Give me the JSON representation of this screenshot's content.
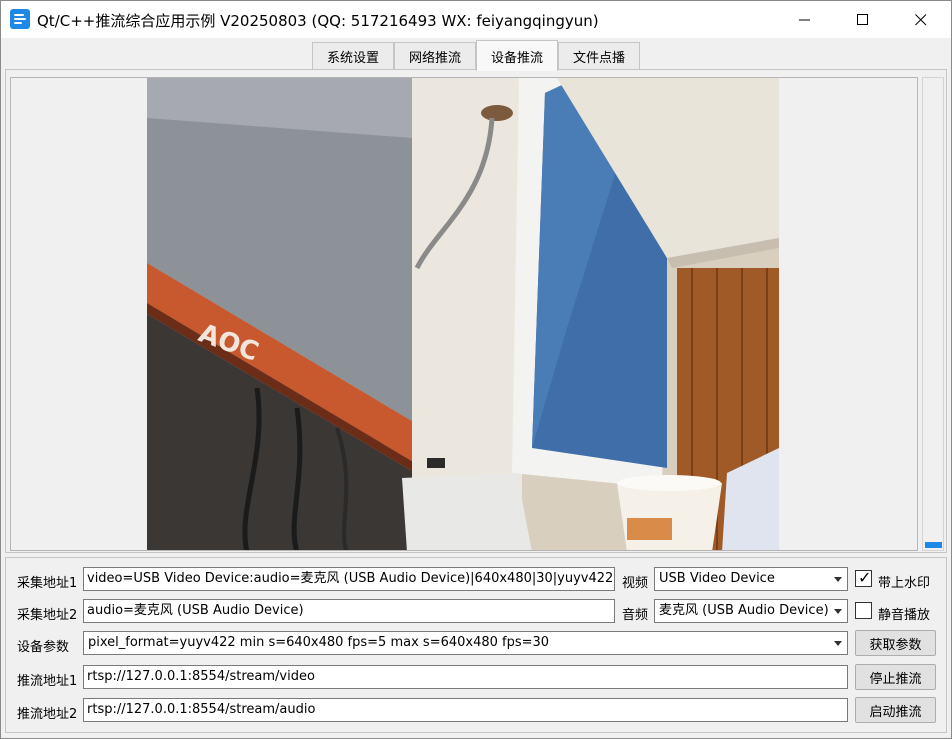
{
  "window": {
    "title": "Qt/C++推流综合应用示例 V20250803 (QQ: 517216493 WX: feiyangqingyun)",
    "icon": "app-menu-icon"
  },
  "tabs": [
    {
      "label": "系统设置",
      "active": false
    },
    {
      "label": "网络推流",
      "active": false
    },
    {
      "label": "设备推流",
      "active": true
    },
    {
      "label": "文件点播",
      "active": false
    }
  ],
  "form": {
    "row1": {
      "label": "采集地址1",
      "value": "video=USB Video Device:audio=麦克风 (USB Audio Device)|640x480|30|yuyv422",
      "video_label": "视频",
      "video_selected": "USB Video Device",
      "watermark_label": "带上水印",
      "watermark_checked": true
    },
    "row2": {
      "label": "采集地址2",
      "value": "audio=麦克风 (USB Audio Device)",
      "audio_label": "音频",
      "audio_selected": "麦克风 (USB Audio Device)",
      "mute_label": "静音播放",
      "mute_checked": false
    },
    "row3": {
      "label": "设备参数",
      "selected": "pixel_format=yuyv422 min s=640x480 fps=5 max s=640x480 fps=30",
      "button": "获取参数"
    },
    "row4": {
      "label": "推流地址1",
      "value": "rtsp://127.0.0.1:8554/stream/video",
      "button": "停止推流"
    },
    "row5": {
      "label": "推流地址2",
      "value": "rtsp://127.0.0.1:8554/stream/audio",
      "button": "启动推流"
    }
  },
  "video": {
    "brand_on_monitor": "AOC"
  },
  "colors": {
    "accent": "#1e88e5"
  }
}
